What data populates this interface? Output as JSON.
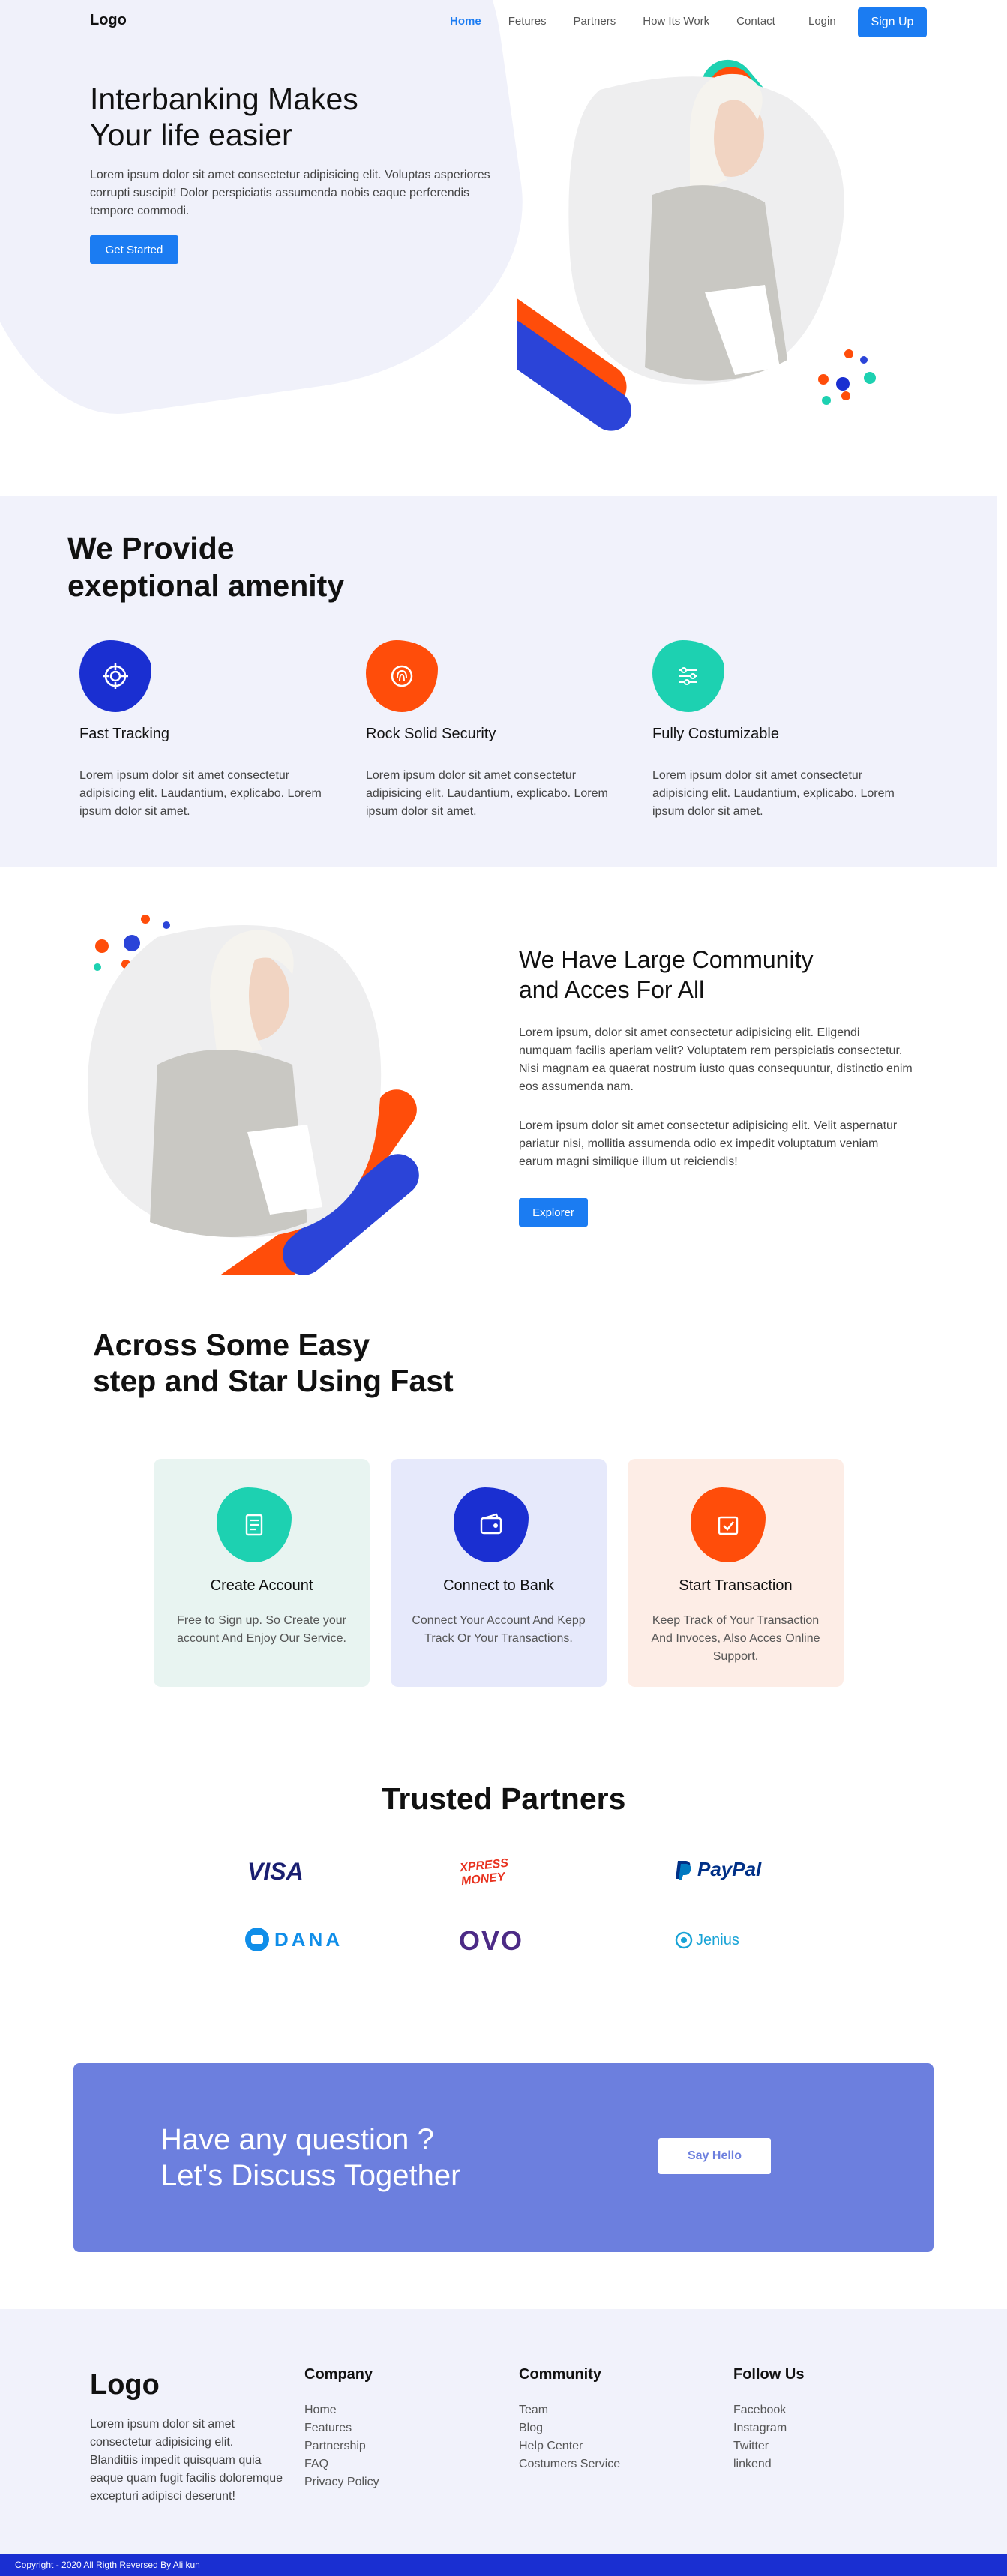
{
  "nav": {
    "logo": "Logo",
    "links": [
      "Home",
      "Fetures",
      "Partners",
      "How Its Work",
      "Contact"
    ],
    "login": "Login",
    "signup": "Sign Up"
  },
  "hero": {
    "title_line1": "Interbanking Makes",
    "title_line2": "Your life easier",
    "text": "Lorem ipsum dolor sit amet consectetur adipisicing elit. Voluptas asperiores corrupti suscipit! Dolor perspiciatis assumenda nobis eaque perferendis tempore commodi.",
    "button": "Get Started"
  },
  "features": {
    "title_line1": "We Provide",
    "title_line2": "exeptional amenity",
    "items": [
      {
        "name": "Fast Tracking",
        "text": "Lorem ipsum dolor sit amet consectetur adipisicing elit. Laudantium, explicabo. Lorem ipsum dolor sit amet.",
        "color": "#1a2fd1",
        "icon": "target-icon"
      },
      {
        "name": "Rock Solid Security",
        "text": "Lorem ipsum dolor sit amet consectetur adipisicing elit. Laudantium, explicabo. Lorem ipsum dolor sit amet.",
        "color": "#ff4d0a",
        "icon": "fingerprint-icon"
      },
      {
        "name": "Fully Costumizable",
        "text": "Lorem ipsum dolor sit amet consectetur adipisicing elit. Laudantium, explicabo. Lorem ipsum dolor sit amet.",
        "color": "#1dd1b1",
        "icon": "sliders-icon"
      }
    ]
  },
  "community": {
    "title_line1": "We Have Large Community",
    "title_line2": "and Acces For All",
    "p1": "Lorem ipsum, dolor sit amet consectetur adipisicing elit. Eligendi numquam facilis aperiam velit? Voluptatem rem perspiciatis consectetur. Nisi magnam ea quaerat nostrum iusto quas consequuntur, distinctio enim eos assumenda nam.",
    "p2": "Lorem ipsum dolor sit amet consectetur adipisicing elit. Velit aspernatur pariatur nisi, mollitia assumenda odio ex impedit voluptatum veniam earum magni similique illum ut reiciendis!",
    "button": "Explorer"
  },
  "steps": {
    "title_line1": "Across Some Easy",
    "title_line2": "step and Star Using Fast",
    "items": [
      {
        "name": "Create Account",
        "text": "Free to Sign up. So Create your account And Enjoy Our Service.",
        "bg": "#e8f4f1",
        "color": "#1dd1b1",
        "icon": "document-icon"
      },
      {
        "name": "Connect to Bank",
        "text": "Connect Your Account And Kepp Track Or Your Transactions.",
        "bg": "#e6e9fb",
        "color": "#1a2fd1",
        "icon": "wallet-icon"
      },
      {
        "name": "Start Transaction",
        "text": "Keep Track of Your Transaction And Invoces, Also Acces Online Support.",
        "bg": "#fdede6",
        "color": "#ff4d0a",
        "icon": "checkbox-icon"
      }
    ]
  },
  "partners": {
    "title": "Trusted Partners",
    "logos": [
      {
        "name": "VISA",
        "color": "#1a1f71"
      },
      {
        "name": "XPRESS MONEY",
        "color": "#e8321f"
      },
      {
        "name": "PayPal",
        "color": "#003087"
      },
      {
        "name": "DANA",
        "color": "#108ee9"
      },
      {
        "name": "OVO",
        "color": "#4c2a86"
      },
      {
        "name": "Jenius",
        "color": "#18a3d6"
      }
    ]
  },
  "cta": {
    "line1": "Have any question ?",
    "line2": "Let's Discuss Together",
    "button": "Say Hello"
  },
  "footer": {
    "logo": "Logo",
    "desc": "Lorem ipsum dolor sit amet consectetur adipisicing elit. Blanditiis impedit quisquam quia eaque quam fugit facilis doloremque excepturi adipisci deserunt!",
    "columns": [
      {
        "title": "Company",
        "items": [
          "Home",
          "Features",
          "Partnership",
          "FAQ",
          "Privacy Policy"
        ]
      },
      {
        "title": "Community",
        "items": [
          "Team",
          "Blog",
          "Help Center",
          "Costumers Service"
        ]
      },
      {
        "title": "Follow Us",
        "items": [
          "Facebook",
          "Instagram",
          "Twitter",
          "linkend"
        ]
      }
    ],
    "copyright": "Copyright - 2020 All Rigth Reversed By Ali kun"
  },
  "colors": {
    "primary": "#1b7cf2",
    "blue": "#1a2fd1",
    "orange": "#ff4d0a",
    "teal": "#1dd1b1",
    "cta": "#6c7fde",
    "light_bg": "#f1f2fb"
  }
}
